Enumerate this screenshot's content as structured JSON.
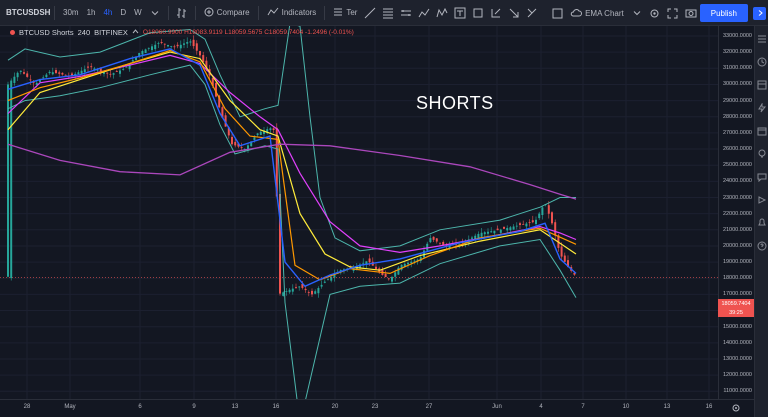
{
  "toolbar": {
    "symbol": "BTCUSDSHO",
    "intervals": [
      "30m",
      "1h",
      "4h",
      "D",
      "W"
    ],
    "active_interval": "4h",
    "compare_label": "Compare",
    "indicators_label": "Indicators",
    "templates_label": "Ter",
    "layout_label": "EMA Chart",
    "publish_label": "Publish"
  },
  "legend": {
    "title": "BTCUSD Shorts",
    "interval": "240",
    "exchange": "BITFINEX",
    "ohlc": "O18060.9900 H18083.9119 L18059.5675 C18059.7404  -1.2496 (-0.01%)"
  },
  "annotation": "SHORTS",
  "price_axis": {
    "ticks": [
      "33000.0000",
      "32000.0000",
      "31000.0000",
      "30000.0000",
      "29000.0000",
      "28000.0000",
      "27000.0000",
      "26000.0000",
      "25000.0000",
      "24000.0000",
      "23000.0000",
      "22000.0000",
      "21000.0000",
      "20000.0000",
      "19000.0000",
      "18000.0000",
      "17000.0000",
      "16000.0000",
      "15000.0000",
      "14000.0000",
      "13000.0000",
      "12000.0000",
      "11000.0000"
    ],
    "last_price": "18059.7404",
    "countdown": "39:25"
  },
  "time_axis": {
    "ticks": [
      "28",
      "May",
      "6",
      "9",
      "13",
      "16",
      "20",
      "23",
      "27",
      "Jun",
      "4",
      "7",
      "10",
      "13",
      "16"
    ]
  },
  "colors": {
    "background": "#131722",
    "up": "#26a69a",
    "down": "#ef5350",
    "accent": "#2962ff"
  }
}
